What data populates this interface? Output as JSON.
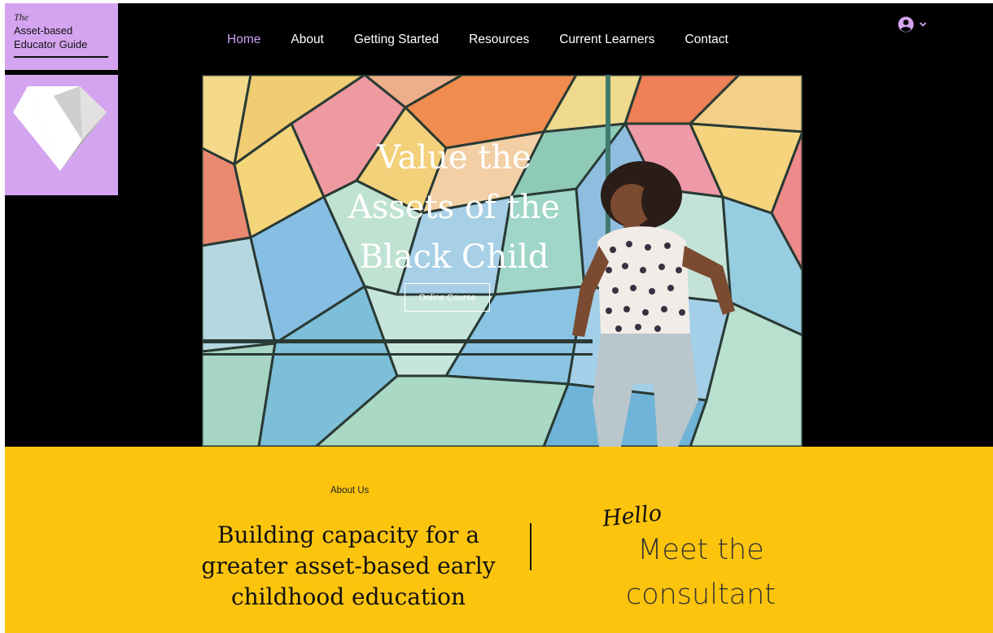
{
  "logo": {
    "the": "The",
    "line1": "Asset-based",
    "line2": "Educator Guide"
  },
  "nav": {
    "items": [
      {
        "label": "Home",
        "active": true
      },
      {
        "label": "About",
        "active": false
      },
      {
        "label": "Getting Started",
        "active": false
      },
      {
        "label": "Resources",
        "active": false
      },
      {
        "label": "Current Learners",
        "active": false
      },
      {
        "label": "Contact",
        "active": false
      }
    ],
    "account_icon": "user-circle-icon",
    "account_chevron": "chevron-down-icon"
  },
  "hero": {
    "title_lines": [
      "Value the",
      "Assets of the",
      "Black Child"
    ],
    "button_label": "Online Course"
  },
  "about": {
    "label": "About Us",
    "heading_lines": [
      "Building capacity for a",
      "greater asset-based early",
      "childhood education"
    ],
    "hello": "Hello",
    "meet_lines": [
      "Meet the",
      "consultant"
    ]
  },
  "colors": {
    "accent_purple": "#d4a4f0",
    "nav_active": "#c9a0f0",
    "section_yellow": "#fcc40d",
    "page_black": "#000000"
  }
}
